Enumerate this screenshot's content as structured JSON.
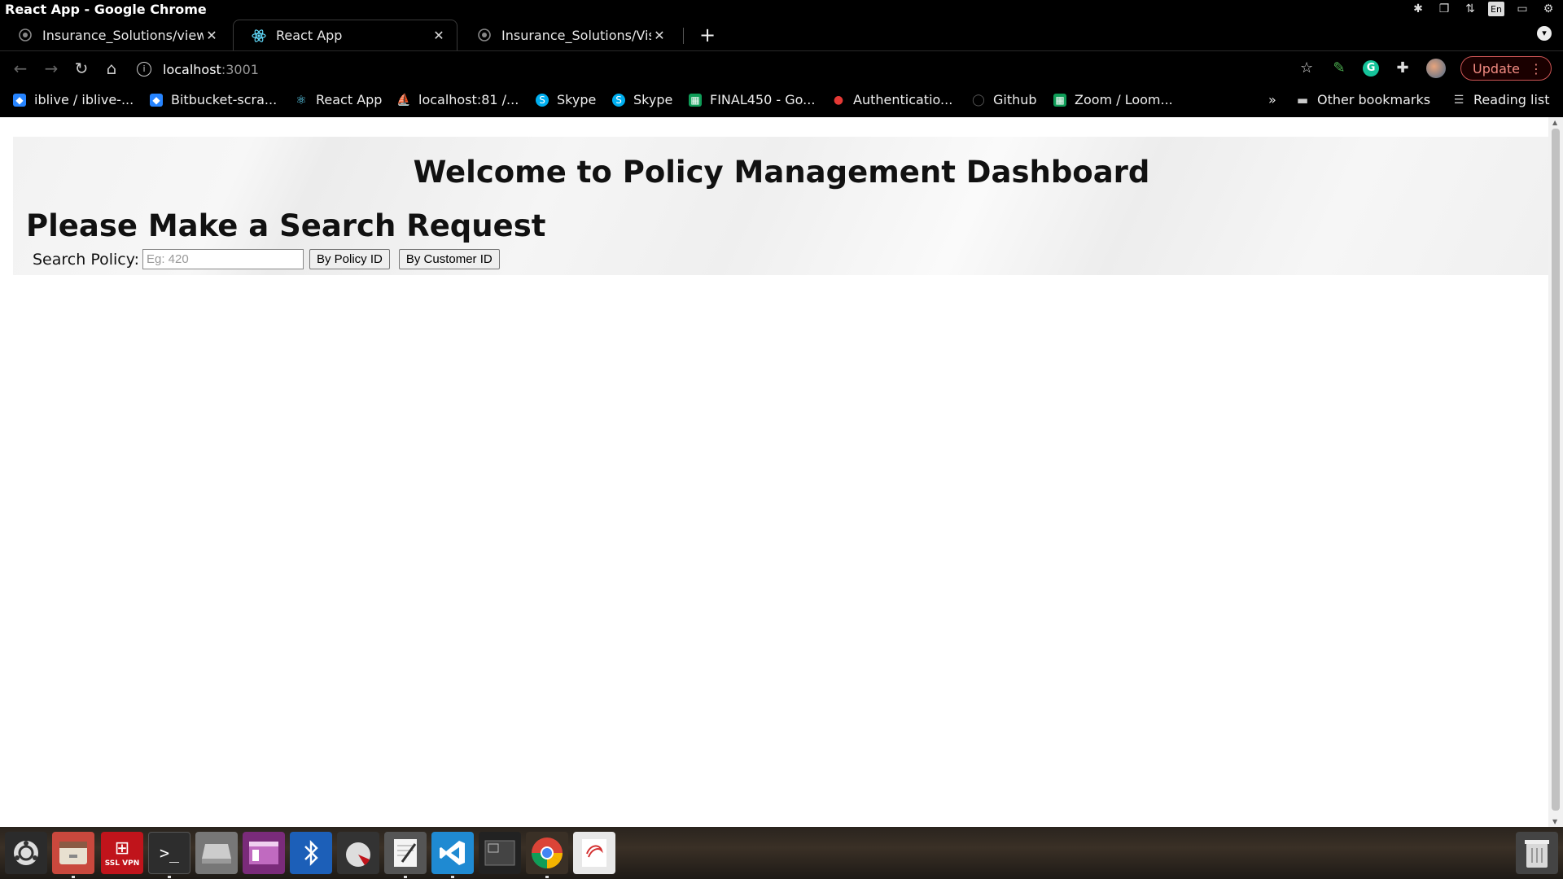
{
  "window": {
    "title": "React App - Google Chrome"
  },
  "tray": {
    "language": "En"
  },
  "tabs": [
    {
      "label": "Insurance_Solutions/view",
      "active": false
    },
    {
      "label": "React App",
      "active": true
    },
    {
      "label": "Insurance_Solutions/Visu",
      "active": false
    }
  ],
  "toolbar": {
    "url_host": "localhost",
    "url_port": ":3001",
    "update_label": "Update"
  },
  "bookmarks": [
    {
      "label": "iblive / iblive-...",
      "icon": "bitbucket-icon",
      "color": "#2684ff"
    },
    {
      "label": "Bitbucket-scra...",
      "icon": "bitbucket-icon",
      "color": "#2684ff"
    },
    {
      "label": "React App",
      "icon": "react-icon",
      "color": "#61dafb"
    },
    {
      "label": "localhost:81 /...",
      "icon": "phpmyadmin-icon",
      "color": "#f29111"
    },
    {
      "label": "Skype",
      "icon": "skype-icon",
      "color": "#00aff0"
    },
    {
      "label": "Skype",
      "icon": "skype-icon",
      "color": "#00aff0"
    },
    {
      "label": "FINAL450 - Go...",
      "icon": "sheets-icon",
      "color": "#0f9d58"
    },
    {
      "label": "Authenticatio...",
      "icon": "auth-icon",
      "color": "#e53935"
    },
    {
      "label": "Github",
      "icon": "github-icon",
      "color": "#333333"
    },
    {
      "label": "Zoom / Loom...",
      "icon": "sheets-icon",
      "color": "#0f9d58"
    }
  ],
  "bookmarks_overflow": "»",
  "other_bookmarks": "Other bookmarks",
  "reading_list": "Reading list",
  "page": {
    "title": "Welcome to Policy Management Dashboard",
    "heading": "Please Make a Search Request",
    "search_label": "Search Policy:",
    "search_placeholder": "Eg: 420",
    "search_value": "",
    "by_policy_button": "By Policy ID",
    "by_customer_button": "By Customer ID"
  },
  "taskbar": {
    "ssl_vpn_label": "SSL VPN",
    "items": [
      "ubuntu-menu-icon",
      "files-icon",
      "ssl-vpn-icon",
      "terminal-icon",
      "disk-icon",
      "window-manager-icon",
      "bluetooth-icon",
      "disk-usage-icon",
      "text-editor-icon",
      "vscode-icon",
      "workspace-icon",
      "chrome-icon",
      "evince-icon",
      "trash-icon"
    ]
  }
}
